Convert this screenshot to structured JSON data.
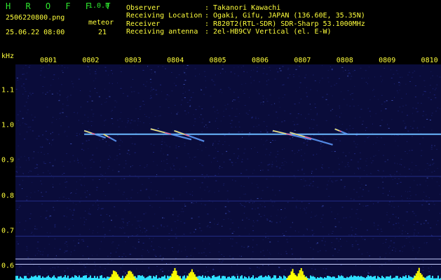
{
  "app": {
    "title": "H R O F F T",
    "version": "1.0.0"
  },
  "capture": {
    "file": "2506220800.png",
    "datetime": "25.06.22 08:00"
  },
  "meteor": {
    "label": "meteor",
    "count": "21"
  },
  "info": [
    {
      "key": "Observer",
      "sep": ":",
      "value": "Takanori Kawachi"
    },
    {
      "key": "Receiving Location",
      "sep": ":",
      "value": "Ogaki, Gifu, JAPAN (136.60E, 35.35N)"
    },
    {
      "key": "Receiver",
      "sep": ":",
      "value": "R820T2(RTL-SDR) SDR-Sharp 53.1000MHz"
    },
    {
      "key": "Receiving antenna",
      "sep": ":",
      "value": "2el-HB9CV Vertical (el. E-W)"
    }
  ],
  "colors": {
    "background": "#000000",
    "header_text": "#ffff3c",
    "title": "#2ee82e",
    "plot_bg": "#0a0c3a",
    "carrier": "#6ab8ff",
    "bottom_bar": "#2ee0ff",
    "bottom_peak": "#ffff00"
  },
  "chart_data": {
    "type": "heatmap",
    "title": "",
    "xlabel": "",
    "ylabel": "kHz",
    "x_ticks": [
      "0801",
      "0802",
      "0803",
      "0804",
      "0805",
      "0806",
      "0807",
      "0808",
      "0809",
      "0810"
    ],
    "y_ticks": [
      "1.1",
      "1.0",
      "0.9",
      "0.8",
      "0.7",
      "0.6"
    ],
    "ylim": [
      0.59,
      1.15
    ],
    "xlim_minutes": [
      0,
      10
    ],
    "carrier_khz": 0.975,
    "carrier_span_minutes": [
      1.0,
      10.0
    ],
    "meteor_traces": [
      {
        "t_start": 1.0,
        "t_end": 1.5,
        "f_start": 0.985,
        "f_end": 0.965
      },
      {
        "t_start": 1.45,
        "t_end": 1.75,
        "f_start": 0.975,
        "f_end": 0.955
      },
      {
        "t_start": 2.55,
        "t_end": 3.5,
        "f_start": 0.99,
        "f_end": 0.96
      },
      {
        "t_start": 3.1,
        "t_end": 3.8,
        "f_start": 0.985,
        "f_end": 0.955
      },
      {
        "t_start": 5.4,
        "t_end": 6.3,
        "f_start": 0.985,
        "f_end": 0.96
      },
      {
        "t_start": 5.8,
        "t_end": 6.8,
        "f_start": 0.98,
        "f_end": 0.945
      },
      {
        "t_start": 6.85,
        "t_end": 7.15,
        "f_start": 0.99,
        "f_end": 0.975
      }
    ],
    "activity_peaks_minutes": [
      1.7,
      2.05,
      3.1,
      3.5,
      5.85,
      6.05,
      8.8
    ]
  }
}
